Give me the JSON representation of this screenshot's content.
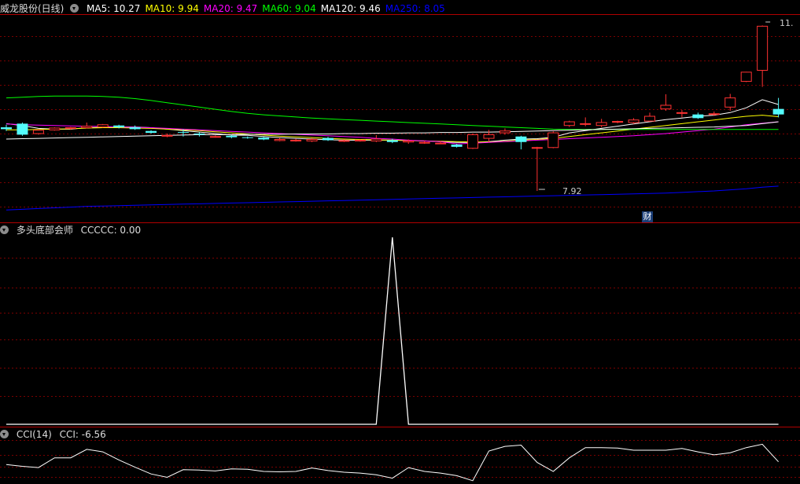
{
  "main_panel": {
    "stock_label": "威龙股份(日线)",
    "ma_legend": [
      {
        "text": "MA5: 10.27",
        "color": "#ffffff"
      },
      {
        "text": "MA10: 9.94",
        "color": "#ffff00"
      },
      {
        "text": "MA20: 9.47",
        "color": "#ff00ff"
      },
      {
        "text": "MA60: 9.04",
        "color": "#00ff00"
      },
      {
        "text": "MA120: 9.46",
        "color": "#ffffff"
      },
      {
        "text": "MA250: 8.05",
        "color": "#0000ff"
      }
    ],
    "high_label": "11.",
    "low_label": "7.92",
    "cai_badge": "财"
  },
  "indicator_panel_1": {
    "title": "多头底部会师",
    "value_text": "CCCCC: 0.00"
  },
  "indicator_panel_2": {
    "title": "CCI(14)",
    "value_text": "CCI: -6.56"
  },
  "chart_data": [
    {
      "type": "candlestick",
      "candles": [
        [
          9.65,
          9.6,
          9.72,
          9.55
        ],
        [
          9.75,
          9.45,
          9.78,
          9.42
        ],
        [
          9.48,
          9.57,
          9.6,
          9.45
        ],
        [
          9.58,
          9.63,
          9.65,
          9.56
        ],
        [
          9.62,
          9.64,
          9.66,
          9.58
        ],
        [
          9.64,
          9.68,
          9.78,
          9.62
        ],
        [
          9.66,
          9.72,
          9.74,
          9.64
        ],
        [
          9.7,
          9.65,
          9.72,
          9.62
        ],
        [
          9.65,
          9.6,
          9.7,
          9.58
        ],
        [
          9.55,
          9.5,
          9.57,
          9.48
        ],
        [
          9.42,
          9.43,
          9.48,
          9.38
        ],
        [
          9.52,
          9.5,
          9.6,
          9.4
        ],
        [
          9.48,
          9.45,
          9.52,
          9.4
        ],
        [
          9.4,
          9.4,
          9.43,
          9.37
        ],
        [
          9.42,
          9.38,
          9.44,
          9.35
        ],
        [
          9.38,
          9.36,
          9.4,
          9.34
        ],
        [
          9.37,
          9.32,
          9.39,
          9.3
        ],
        [
          9.29,
          9.32,
          9.36,
          9.27
        ],
        [
          9.28,
          9.3,
          9.34,
          9.26
        ],
        [
          9.28,
          9.32,
          9.36,
          9.25
        ],
        [
          9.36,
          9.3,
          9.39,
          9.28
        ],
        [
          9.29,
          9.29,
          9.32,
          9.25
        ],
        [
          9.28,
          9.3,
          9.32,
          9.26
        ],
        [
          9.28,
          9.33,
          9.44,
          9.25
        ],
        [
          9.3,
          9.25,
          9.34,
          9.22
        ],
        [
          9.25,
          9.28,
          9.32,
          9.2
        ],
        [
          9.24,
          9.24,
          9.28,
          9.2
        ],
        [
          9.22,
          9.22,
          9.27,
          9.2
        ],
        [
          9.18,
          9.12,
          9.2,
          9.1
        ],
        [
          9.08,
          9.45,
          9.48,
          9.06
        ],
        [
          9.35,
          9.45,
          9.58,
          9.25
        ],
        [
          9.5,
          9.55,
          9.62,
          9.45
        ],
        [
          9.4,
          9.25,
          9.42,
          9.05
        ],
        [
          9.08,
          9.1,
          9.12,
          7.92
        ],
        [
          9.1,
          9.5,
          9.54,
          9.08
        ],
        [
          9.7,
          9.8,
          9.83,
          9.66
        ],
        [
          9.75,
          9.75,
          9.92,
          9.68
        ],
        [
          9.7,
          9.78,
          9.88,
          9.65
        ],
        [
          9.8,
          9.81,
          9.83,
          9.76
        ],
        [
          9.78,
          9.85,
          9.9,
          9.74
        ],
        [
          9.82,
          9.95,
          10.05,
          9.8
        ],
        [
          10.15,
          10.25,
          10.55,
          10.1
        ],
        [
          10.05,
          10.05,
          10.12,
          9.92
        ],
        [
          10.0,
          9.9,
          10.05,
          9.88
        ],
        [
          10.0,
          10.02,
          10.08,
          9.96
        ],
        [
          10.2,
          10.45,
          10.56,
          10.1
        ],
        [
          10.9,
          11.15,
          11.16,
          10.88
        ],
        [
          11.2,
          12.4,
          12.42,
          10.75
        ],
        [
          10.15,
          10.0,
          10.45,
          9.92
        ]
      ],
      "ma_series": [
        {
          "name": "MA5",
          "color": "#ffffff",
          "values": [
            9.75,
            9.7,
            9.62,
            9.6,
            9.6,
            9.64,
            9.65,
            9.66,
            9.66,
            9.64,
            9.6,
            9.56,
            9.52,
            9.48,
            9.44,
            9.43,
            9.4,
            9.37,
            9.35,
            9.33,
            9.31,
            9.3,
            9.3,
            9.3,
            9.3,
            9.29,
            9.28,
            9.26,
            9.24,
            9.24,
            9.26,
            9.3,
            9.33,
            9.34,
            9.38,
            9.5,
            9.56,
            9.62,
            9.68,
            9.74,
            9.8,
            9.86,
            9.9,
            9.95,
            9.98,
            10.05,
            10.18,
            10.4,
            10.27
          ]
        },
        {
          "name": "MA10",
          "color": "#ffff00",
          "values": [
            9.58,
            9.58,
            9.59,
            9.6,
            9.61,
            9.63,
            9.64,
            9.64,
            9.63,
            9.62,
            9.6,
            9.58,
            9.56,
            9.53,
            9.5,
            9.47,
            9.44,
            9.41,
            9.39,
            9.37,
            9.35,
            9.33,
            9.32,
            9.31,
            9.3,
            9.29,
            9.28,
            9.27,
            9.26,
            9.25,
            9.25,
            9.27,
            9.3,
            9.32,
            9.35,
            9.4,
            9.45,
            9.5,
            9.55,
            9.6,
            9.65,
            9.7,
            9.75,
            9.8,
            9.85,
            9.9,
            9.95,
            9.98,
            9.94
          ]
        },
        {
          "name": "MA20",
          "color": "#ff00ff",
          "values": [
            9.74,
            9.72,
            9.71,
            9.7,
            9.69,
            9.68,
            9.67,
            9.66,
            9.65,
            9.64,
            9.62,
            9.6,
            9.58,
            9.56,
            9.54,
            9.52,
            9.5,
            9.48,
            9.46,
            9.44,
            9.42,
            9.4,
            9.38,
            9.35,
            9.33,
            9.3,
            9.28,
            9.26,
            9.2,
            9.22,
            9.24,
            9.26,
            9.28,
            9.3,
            9.32,
            9.34,
            9.36,
            9.38,
            9.4,
            9.42,
            9.45,
            9.48,
            9.52,
            9.56,
            9.6,
            9.66,
            9.72,
            9.76,
            9.8
          ]
        },
        {
          "name": "MA60",
          "color": "#00ff00",
          "values": [
            10.45,
            10.47,
            10.49,
            10.5,
            10.5,
            10.5,
            10.49,
            10.47,
            10.43,
            10.38,
            10.32,
            10.26,
            10.2,
            10.14,
            10.08,
            10.03,
            9.99,
            9.96,
            9.93,
            9.9,
            9.88,
            9.86,
            9.84,
            9.82,
            9.8,
            9.78,
            9.76,
            9.74,
            9.72,
            9.7,
            9.68,
            9.66,
            9.64,
            9.62,
            9.6,
            9.59,
            9.59,
            9.59,
            9.59,
            9.59,
            9.59,
            9.59,
            9.59,
            9.59,
            9.59,
            9.59,
            9.59,
            9.59,
            9.59
          ]
        },
        {
          "name": "MA120",
          "color": "#ffffff",
          "values": [
            9.33,
            9.34,
            9.35,
            9.36,
            9.37,
            9.38,
            9.39,
            9.4,
            9.41,
            9.42,
            9.43,
            9.44,
            9.45,
            9.45,
            9.45,
            9.46,
            9.46,
            9.46,
            9.47,
            9.47,
            9.47,
            9.48,
            9.48,
            9.49,
            9.49,
            9.5,
            9.5,
            9.51,
            9.51,
            9.52,
            9.52,
            9.53,
            9.54,
            9.55,
            9.56,
            9.57,
            9.58,
            9.59,
            9.6,
            9.61,
            9.62,
            9.63,
            9.64,
            9.65,
            9.66,
            9.68,
            9.7,
            9.75,
            9.8
          ]
        },
        {
          "name": "MA250",
          "color": "#0000ff",
          "values": [
            7.4,
            7.42,
            7.44,
            7.46,
            7.48,
            7.5,
            7.51,
            7.52,
            7.53,
            7.54,
            7.55,
            7.56,
            7.57,
            7.58,
            7.59,
            7.6,
            7.61,
            7.62,
            7.63,
            7.64,
            7.65,
            7.66,
            7.67,
            7.68,
            7.69,
            7.7,
            7.71,
            7.72,
            7.73,
            7.74,
            7.75,
            7.76,
            7.77,
            7.78,
            7.79,
            7.8,
            7.81,
            7.82,
            7.83,
            7.84,
            7.85,
            7.86,
            7.88,
            7.9,
            7.92,
            7.95,
            7.98,
            8.02,
            8.05
          ]
        }
      ],
      "ylim": [
        7.3,
        12.6
      ]
    },
    {
      "type": "line",
      "name": "CCCCC",
      "color": "#ffffff",
      "values": [
        0,
        0,
        0,
        0,
        0,
        0,
        0,
        0,
        0,
        0,
        0,
        0,
        0,
        0,
        0,
        0,
        0,
        0,
        0,
        0,
        0,
        0,
        0,
        0,
        100,
        0,
        0,
        0,
        0,
        0,
        0,
        0,
        0,
        0,
        0,
        0,
        0,
        0,
        0,
        0,
        0,
        0,
        0,
        0,
        0,
        0,
        0,
        0,
        0
      ],
      "ylim": [
        0,
        100
      ]
    },
    {
      "type": "line",
      "name": "CCI",
      "color": "#ffffff",
      "values": [
        -40,
        -60,
        -75,
        40,
        40,
        140,
        110,
        15,
        -70,
        -150,
        -190,
        -100,
        -105,
        -115,
        -90,
        -95,
        -120,
        -125,
        -120,
        -80,
        -110,
        -130,
        -140,
        -160,
        -200,
        -75,
        -120,
        -140,
        -170,
        -230,
        120,
        175,
        190,
        -15,
        -120,
        40,
        160,
        160,
        155,
        130,
        130,
        130,
        150,
        110,
        75,
        100,
        160,
        200,
        -6.56
      ],
      "ylim": [
        -250,
        250
      ]
    }
  ]
}
